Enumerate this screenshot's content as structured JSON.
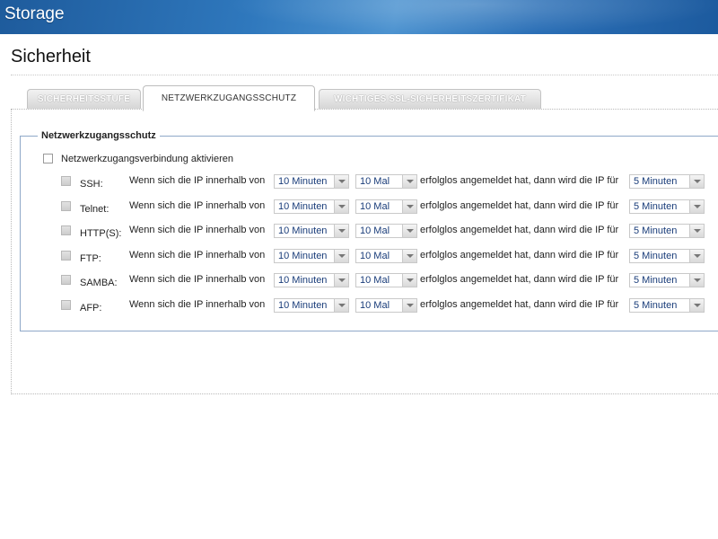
{
  "app": {
    "title": "Storage"
  },
  "page": {
    "title": "Sicherheit"
  },
  "tabs": [
    {
      "label": "SICHERHEITSSTUFE",
      "active": false
    },
    {
      "label": "NETZWERKZUGANGSSCHUTZ",
      "active": true
    },
    {
      "label": "WICHTIGES SSL-SICHERHEITSZERTIFIKAT",
      "active": false
    }
  ],
  "section": {
    "legend": "Netzwerkzugangsschutz",
    "enable_label": "Netzwerkzugangsverbindung aktivieren",
    "enable_checked": false,
    "text_within": "Wenn sich die IP innerhalb von",
    "text_failed": "erfolglos angemeldet hat, dann wird die IP für",
    "rows": [
      {
        "service": "SSH:",
        "within": "10 Minuten",
        "attempts": "10 Mal",
        "block": "5 Minuten"
      },
      {
        "service": "Telnet:",
        "within": "10 Minuten",
        "attempts": "10 Mal",
        "block": "5 Minuten"
      },
      {
        "service": "HTTP(S):",
        "within": "10 Minuten",
        "attempts": "10 Mal",
        "block": "5 Minuten"
      },
      {
        "service": "FTP:",
        "within": "10 Minuten",
        "attempts": "10 Mal",
        "block": "5 Minuten"
      },
      {
        "service": "SAMBA:",
        "within": "10 Minuten",
        "attempts": "10 Mal",
        "block": "5 Minuten"
      },
      {
        "service": "AFP:",
        "within": "10 Minuten",
        "attempts": "10 Mal",
        "block": "5 Minuten"
      }
    ]
  }
}
